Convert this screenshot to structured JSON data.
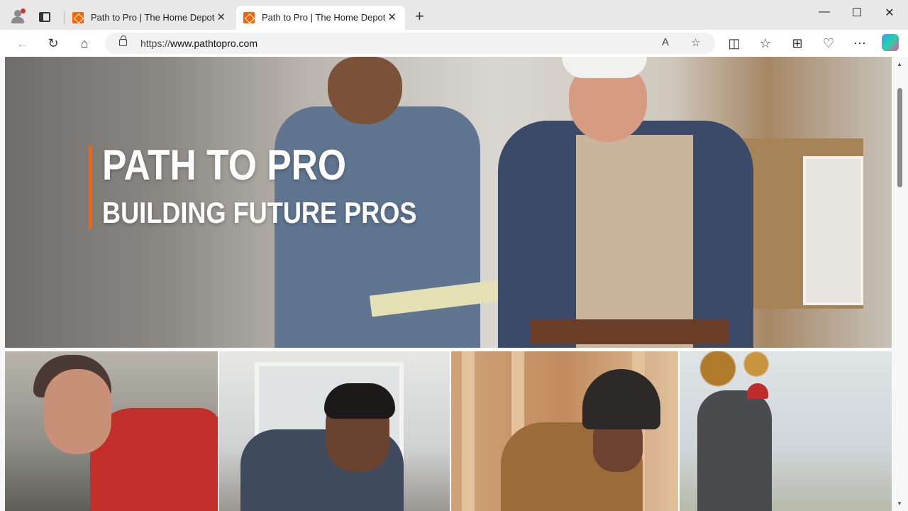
{
  "browser": {
    "tabs": [
      {
        "title": "Path to Pro | The Home Depot",
        "active": false
      },
      {
        "title": "Path to Pro | The Home Depot",
        "active": true
      }
    ],
    "new_tab": "+",
    "window_controls": {
      "minimize": "—",
      "maximize": "☐",
      "close": "✕"
    },
    "address": {
      "prefix": "https://",
      "host": "www.pathtopro.com"
    },
    "icons": [
      "back-icon",
      "refresh-icon",
      "home-icon",
      "lock-icon",
      "read-aloud-icon",
      "favorite-star-icon",
      "split-screen-icon",
      "favorites-icon",
      "collections-icon",
      "performance-icon",
      "more-icon",
      "copilot-icon"
    ]
  },
  "hero": {
    "title": "PATH TO PRO",
    "subtitle": "BUILDING FUTURE PROS",
    "accent_color": "#f96302"
  },
  "photo_grid": [
    "worker-red-shirt-photo",
    "worker-headphones-drafting-photo",
    "worker-hardhat-framing-photo",
    "worker-outdoor-shovel-photo"
  ]
}
